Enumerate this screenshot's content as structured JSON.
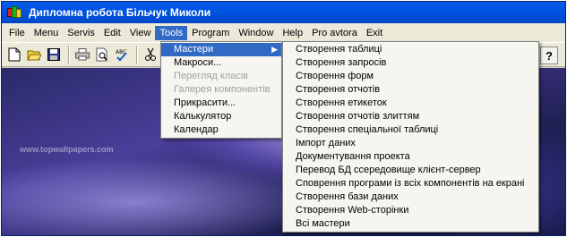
{
  "window": {
    "title": "Дипломна робота Більчук Миколи"
  },
  "menubar": {
    "items": [
      {
        "label": "File"
      },
      {
        "label": "Menu"
      },
      {
        "label": "Servis"
      },
      {
        "label": "Edit"
      },
      {
        "label": "View"
      },
      {
        "label": "Tools"
      },
      {
        "label": "Program"
      },
      {
        "label": "Window"
      },
      {
        "label": "Help"
      },
      {
        "label": "Pro avtora"
      },
      {
        "label": "Exit"
      }
    ],
    "active": "Tools"
  },
  "toolbar": {
    "icons": [
      "new-document-icon",
      "open-folder-icon",
      "save-icon",
      "print-icon",
      "print-preview-icon",
      "spell-check-icon",
      "cut-icon"
    ],
    "help_label": "?"
  },
  "background": {
    "watermark": "www.topwallpapers.com"
  },
  "tools_menu": {
    "items": [
      {
        "label": "Мастери",
        "state": "highlighted",
        "has_submenu": true
      },
      {
        "label": "Макроси...",
        "state": "enabled"
      },
      {
        "label": "Перегляд класів",
        "state": "disabled"
      },
      {
        "label": "Галерея компонентів",
        "state": "disabled"
      },
      {
        "label": "Прикрасити...",
        "state": "enabled"
      },
      {
        "label": "Калькулятор",
        "state": "enabled"
      },
      {
        "label": "Календар",
        "state": "enabled"
      }
    ],
    "submenu_arrow": "▶"
  },
  "wizards_menu": {
    "items": [
      {
        "label": "Створення таблиці"
      },
      {
        "label": "Створення запросів"
      },
      {
        "label": "Створення форм"
      },
      {
        "label": "Створення отчотів"
      },
      {
        "label": "Створення етикеток"
      },
      {
        "label": "Створення отчотів злиттям"
      },
      {
        "label": "Створення спеціальної таблиці"
      },
      {
        "label": "Імпорт даних"
      },
      {
        "label": "Документування проекта"
      },
      {
        "label": "Перевод БД ссередовище клієнт-сервер"
      },
      {
        "label": "Споврення програми із всіх компонентів на екрані"
      },
      {
        "label": "Створення бази даних"
      },
      {
        "label": "Створення Web-сторінки"
      },
      {
        "label": "Всі мастери"
      }
    ]
  },
  "colors": {
    "titlebar": "#0054e3",
    "menu_highlight": "#316ac5",
    "disabled_text": "#a0a0a0"
  }
}
